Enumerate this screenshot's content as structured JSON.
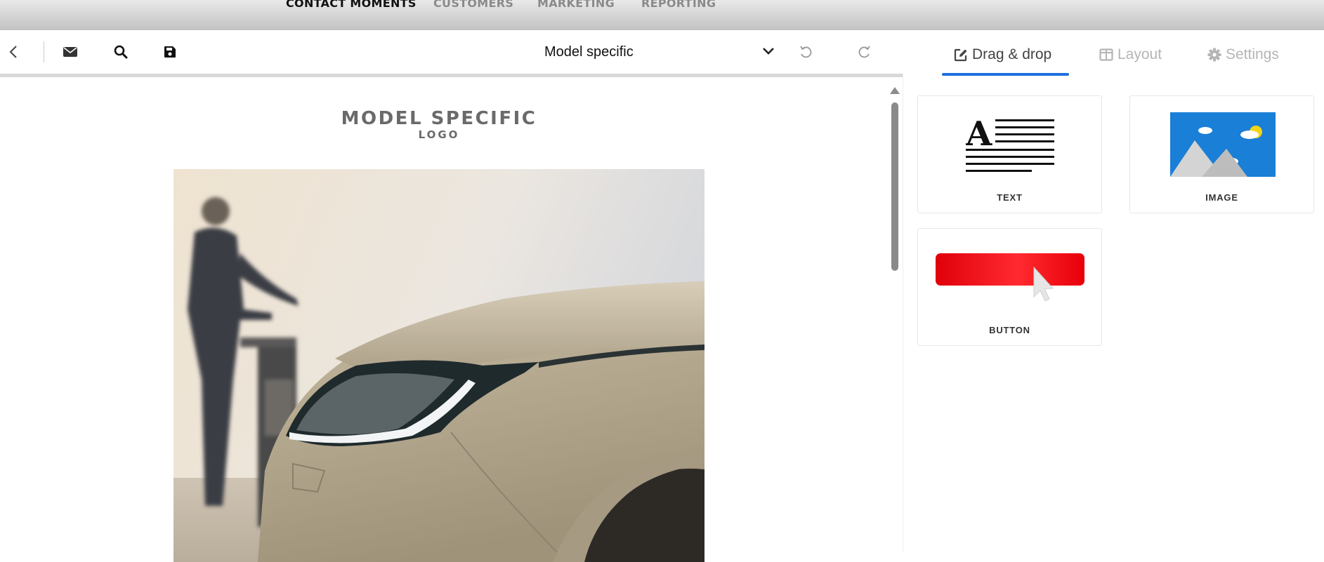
{
  "topnav": {
    "items": [
      {
        "label": "CONTACT MOMENTS",
        "active": true
      },
      {
        "label": "CUSTOMERS",
        "active": false
      },
      {
        "label": "MARKETING",
        "active": false
      },
      {
        "label": "REPORTING",
        "active": false
      }
    ]
  },
  "toolbar": {
    "back_icon": "chevron-left-icon",
    "mail_icon": "envelope-icon",
    "search_icon": "search-icon",
    "save_icon": "save-icon",
    "template_select_value": "Model specific",
    "undo_icon": "undo-icon",
    "redo_icon": "redo-icon"
  },
  "canvas": {
    "logo_line1": "MODEL SPECIFIC",
    "logo_line2": "LOGO"
  },
  "panel": {
    "tabs": [
      {
        "label": "Drag & drop",
        "icon": "edit-icon",
        "active": true
      },
      {
        "label": "Layout",
        "icon": "columns-icon",
        "active": false
      },
      {
        "label": "Settings",
        "icon": "gear-icon",
        "active": false
      }
    ],
    "blocks": [
      {
        "label": "TEXT"
      },
      {
        "label": "IMAGE"
      },
      {
        "label": "BUTTON"
      }
    ]
  },
  "colors": {
    "accent": "#1d6fe0",
    "button_red": "#e8000a",
    "image_blue": "#1a7fd6"
  }
}
